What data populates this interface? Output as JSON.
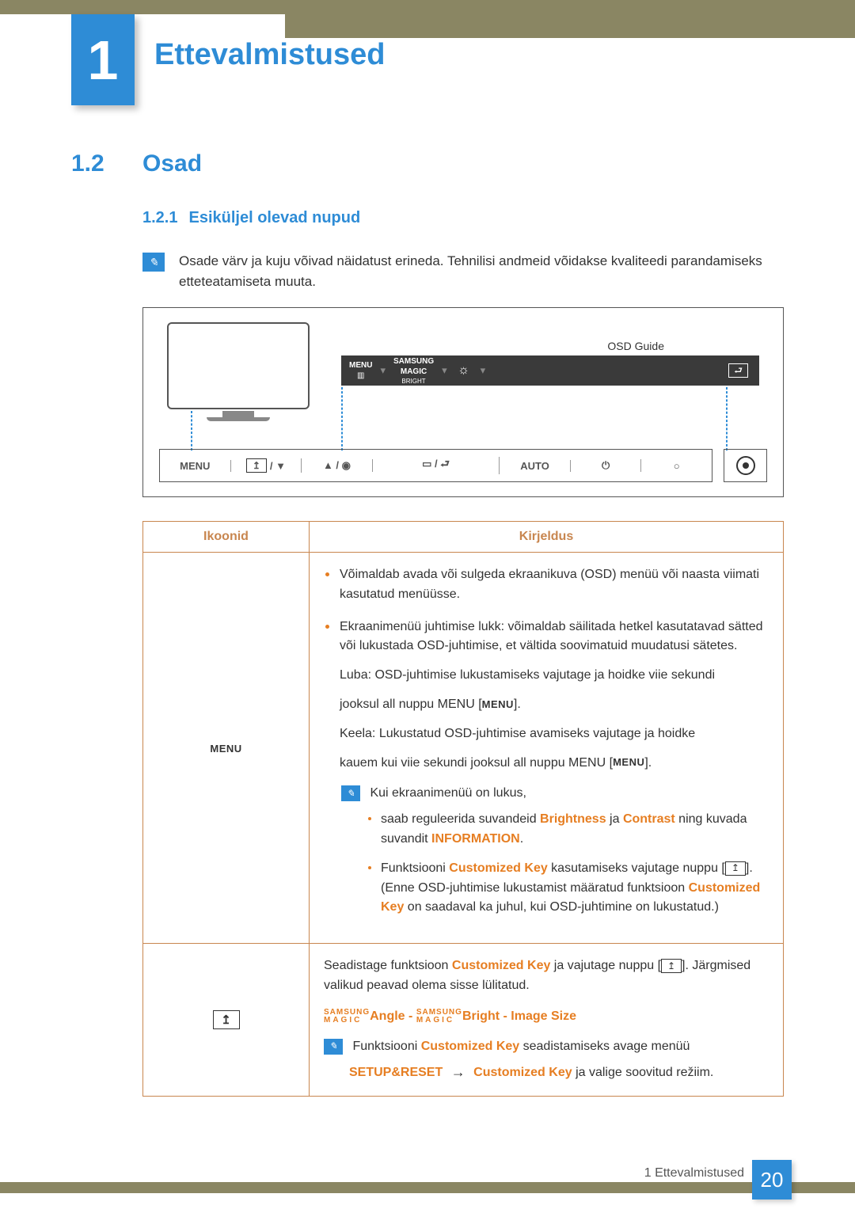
{
  "chapter": {
    "number": "1",
    "title": "Ettevalmistused"
  },
  "section": {
    "number": "1.2",
    "title": "Osad"
  },
  "subsection": {
    "number": "1.2.1",
    "title": "Esiküljel olevad nupud"
  },
  "intro_note": "Osade värv ja kuju võivad näidatust erineda. Tehnilisi andmeid võidakse kvaliteedi parandamiseks etteteatamiseta muuta.",
  "figure": {
    "osd_guide": "OSD Guide",
    "osd_menu": "MENU",
    "osd_samsung": "SAMSUNG",
    "osd_magic": "MAGIC",
    "osd_bright": "BRIGHT",
    "controls": {
      "menu": "MENU",
      "auto": "AUTO"
    }
  },
  "table": {
    "headers": {
      "icons": "Ikoonid",
      "desc": "Kirjeldus"
    },
    "row1": {
      "icon_label": "MENU",
      "b1": "Võimaldab avada või sulgeda ekraanikuva (OSD) menüü või naasta viimati kasutatud menüüsse.",
      "b2": "Ekraanimenüü juhtimise lukk: võimaldab säilitada hetkel kasutatavad sätted või lukustada OSD-juhtimise, et vältida soovimatuid muudatusi sätetes.",
      "enable_pre": "Luba: OSD-juhtimise lukustamiseks vajutage ja hoidke viie sekundi",
      "enable_post_a": "jooksul all nuppu MENU [",
      "enable_post_b": "].",
      "disable_pre": "Keela: Lukustatud OSD-juhtimise avamiseks vajutage ja hoidke",
      "disable_post_a": "kauem kui viie sekundi jooksul all nuppu MENU [",
      "disable_post_b": "].",
      "locked_intro": "Kui ekraanimenüü on lukus,",
      "locked_b1_a": "saab reguleerida suvandeid ",
      "locked_b1_brightness": "Brightness",
      "locked_b1_b": " ja ",
      "locked_b1_contrast": "Contrast",
      "locked_b1_c": " ning kuvada suvandit ",
      "locked_b1_info": "INFORMATION",
      "locked_b1_d": ".",
      "locked_b2_a": "Funktsiooni ",
      "locked_b2_ck": "Customized Key",
      "locked_b2_b": " kasutamiseks vajutage nuppu [",
      "locked_b2_c": "]. (Enne OSD-juhtimise lukustamist määratud funktsioon ",
      "locked_b2_ck2": "Customized Key",
      "locked_b2_d": " on saadaval ka juhul, kui OSD-juhtimine on lukustatud.)",
      "menu_small": "MENU"
    },
    "row2": {
      "p1_a": "Seadistage funktsioon ",
      "p1_ck": "Customized Key",
      "p1_b": " ja vajutage nuppu [",
      "p1_c": "]. Järgmised valikud peavad olema sisse lülitatud.",
      "opt_angle": "Angle",
      "opt_bright": "Bright",
      "opt_image": "Image Size",
      "opt_sep": " - ",
      "magic_s": "SAMSUNG",
      "magic_m": "MAGIC",
      "note_a": "Funktsiooni ",
      "note_ck": "Customized Key",
      "note_b": " seadistamiseks avage menüü ",
      "note_setup": "SETUP&RESET",
      "note_arrow": "→",
      "note_ck2": "Customized Key",
      "note_c": " ja valige soovitud režiim."
    }
  },
  "footer": {
    "label": "1 Ettevalmistused",
    "page": "20"
  }
}
